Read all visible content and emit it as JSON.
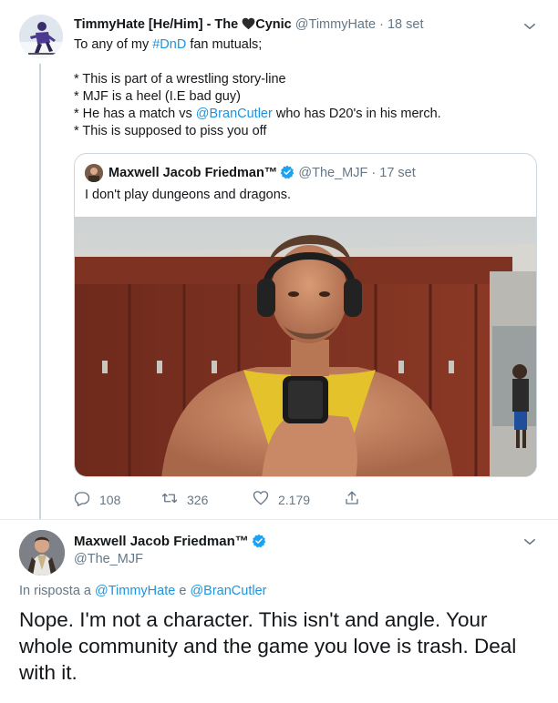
{
  "tweet1": {
    "display_name_prefix": "TimmyHate [He/Him] - The ",
    "display_name_suffix": "Cynic",
    "handle": "@TimmyHate",
    "separator": "·",
    "date": "18 set",
    "line1_text": "To any of my ",
    "line1_hashtag": "#DnD",
    "line1_tail": " fan mutuals;",
    "bullet1": "* This is part of a wrestling story-line",
    "bullet2": "* MJF is a heel (I.E bad guy)",
    "bullet3_pre": "* He has a match vs ",
    "bullet3_mention": "@BranCutler",
    "bullet3_post": " who has D20's in his merch.",
    "bullet4": "* This is supposed to piss you off",
    "quote": {
      "name": "Maxwell Jacob Friedman™",
      "handle": "@The_MJF",
      "separator": "·",
      "date": "17 set",
      "text": "I don't play dungeons and dragons."
    },
    "actions": {
      "replies": "108",
      "retweets": "326",
      "likes": "2.179"
    }
  },
  "tweet2": {
    "name": "Maxwell Jacob Friedman™",
    "handle": "@The_MJF",
    "reply_prefix": "In risposta a ",
    "reply_user1": "@TimmyHate",
    "reply_conj": " e ",
    "reply_user2": "@BranCutler",
    "text": "Nope. I'm not a character. This isn't and angle. Your whole community and the game you love is trash. Deal with it."
  },
  "colors": {
    "link": "#1b95e0",
    "verified": "#1da1f2",
    "muted": "#657786"
  }
}
